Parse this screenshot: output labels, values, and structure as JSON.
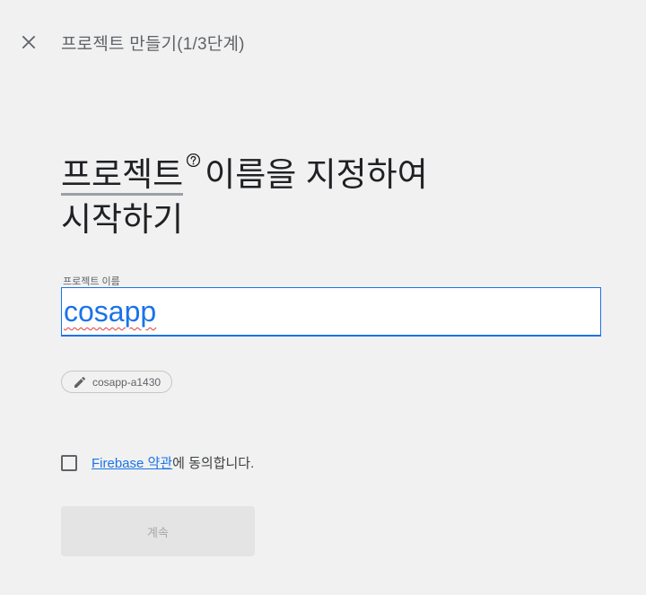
{
  "header": {
    "close_icon": "close-icon",
    "title": "프로젝트 만들기(1/3단계)"
  },
  "heading": {
    "term": "프로젝트",
    "help_icon": "help-circle-icon",
    "line1_rest": "이름을 지정하여",
    "line2": "시작하기"
  },
  "project_name": {
    "label": "프로젝트 이름",
    "value": "cosapp"
  },
  "project_id_chip": {
    "icon": "pencil-icon",
    "value": "cosapp-a1430"
  },
  "terms": {
    "link_text": "Firebase 약관",
    "suffix": "에 동의합니다.",
    "checked": false
  },
  "continue_button": {
    "label": "계속",
    "enabled": false
  },
  "colors": {
    "background": "#f1f1f1",
    "accent": "#1a73e8",
    "text": "#202124",
    "muted": "#5f6368",
    "disabled_bg": "#e4e4e4",
    "disabled_text": "#a8a8a8"
  }
}
